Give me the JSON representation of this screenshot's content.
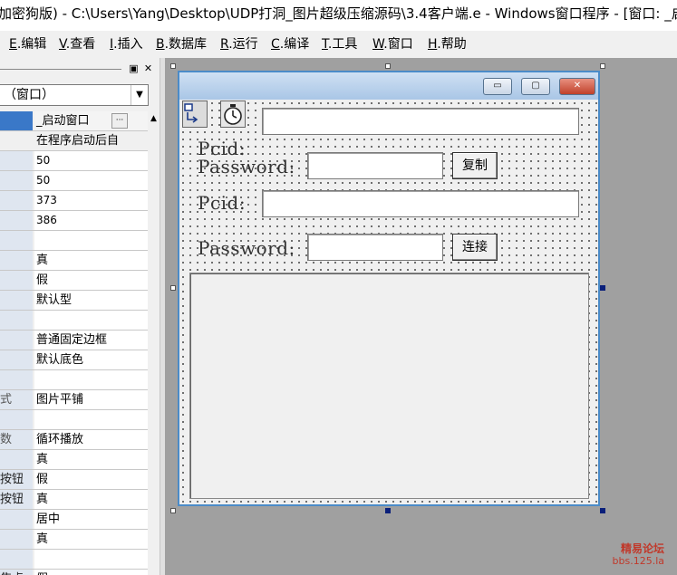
{
  "window": {
    "title": "加密狗版) - C:\\Users\\Yang\\Desktop\\UDP打洞_图片超级压缩源码\\3.4客户端.e - Windows窗口程序 - [窗口: _启动"
  },
  "menu": [
    {
      "key": "E",
      "label": ".编辑"
    },
    {
      "key": "V",
      "label": ".查看"
    },
    {
      "key": "I",
      "label": ".插入"
    },
    {
      "key": "B",
      "label": ".数据库"
    },
    {
      "key": "R",
      "label": ".运行"
    },
    {
      "key": "C",
      "label": ".编译"
    },
    {
      "key": "T",
      "label": ".工具"
    },
    {
      "key": "W",
      "label": ".窗口"
    },
    {
      "key": "H",
      "label": ".帮助"
    }
  ],
  "panel": {
    "combo_text": "（窗口）",
    "ellipsis": "···",
    "rows": [
      {
        "k": "",
        "v": "_启动窗口"
      },
      {
        "k": "",
        "v": "在程序启动后自"
      },
      {
        "k": "",
        "v": "50"
      },
      {
        "k": "",
        "v": "50"
      },
      {
        "k": "",
        "v": "373"
      },
      {
        "k": "",
        "v": "386"
      },
      {
        "k": "",
        "v": ""
      },
      {
        "k": "",
        "v": "真"
      },
      {
        "k": "",
        "v": "假"
      },
      {
        "k": "",
        "v": "默认型"
      },
      {
        "k": "",
        "v": ""
      },
      {
        "k": "",
        "v": "普通固定边框"
      },
      {
        "k": "",
        "v": "默认底色"
      },
      {
        "k": "",
        "v": ""
      },
      {
        "k": "式",
        "v": "图片平铺"
      },
      {
        "k": "",
        "v": ""
      },
      {
        "k": "数",
        "v": "循环播放"
      },
      {
        "k": "",
        "v": "真"
      },
      {
        "k": "按钮",
        "v": "假"
      },
      {
        "k": "按钮",
        "v": "真"
      },
      {
        "k": "",
        "v": "居中"
      },
      {
        "k": "",
        "v": "真"
      },
      {
        "k": "",
        "v": ""
      },
      {
        "k": "焦点",
        "v": "假"
      }
    ]
  },
  "form": {
    "min_glyph": "▭",
    "max_glyph": "▢",
    "close_glyph": "✕",
    "label_pcid_1": "Pcid:",
    "label_password_1": "Password:",
    "copy_button": "复制",
    "label_pcid_2": "Pcid:",
    "label_password_2": "Password:",
    "connect_button": "连接"
  },
  "watermark": {
    "line1": "精易论坛",
    "line2": "bbs.125.la"
  }
}
